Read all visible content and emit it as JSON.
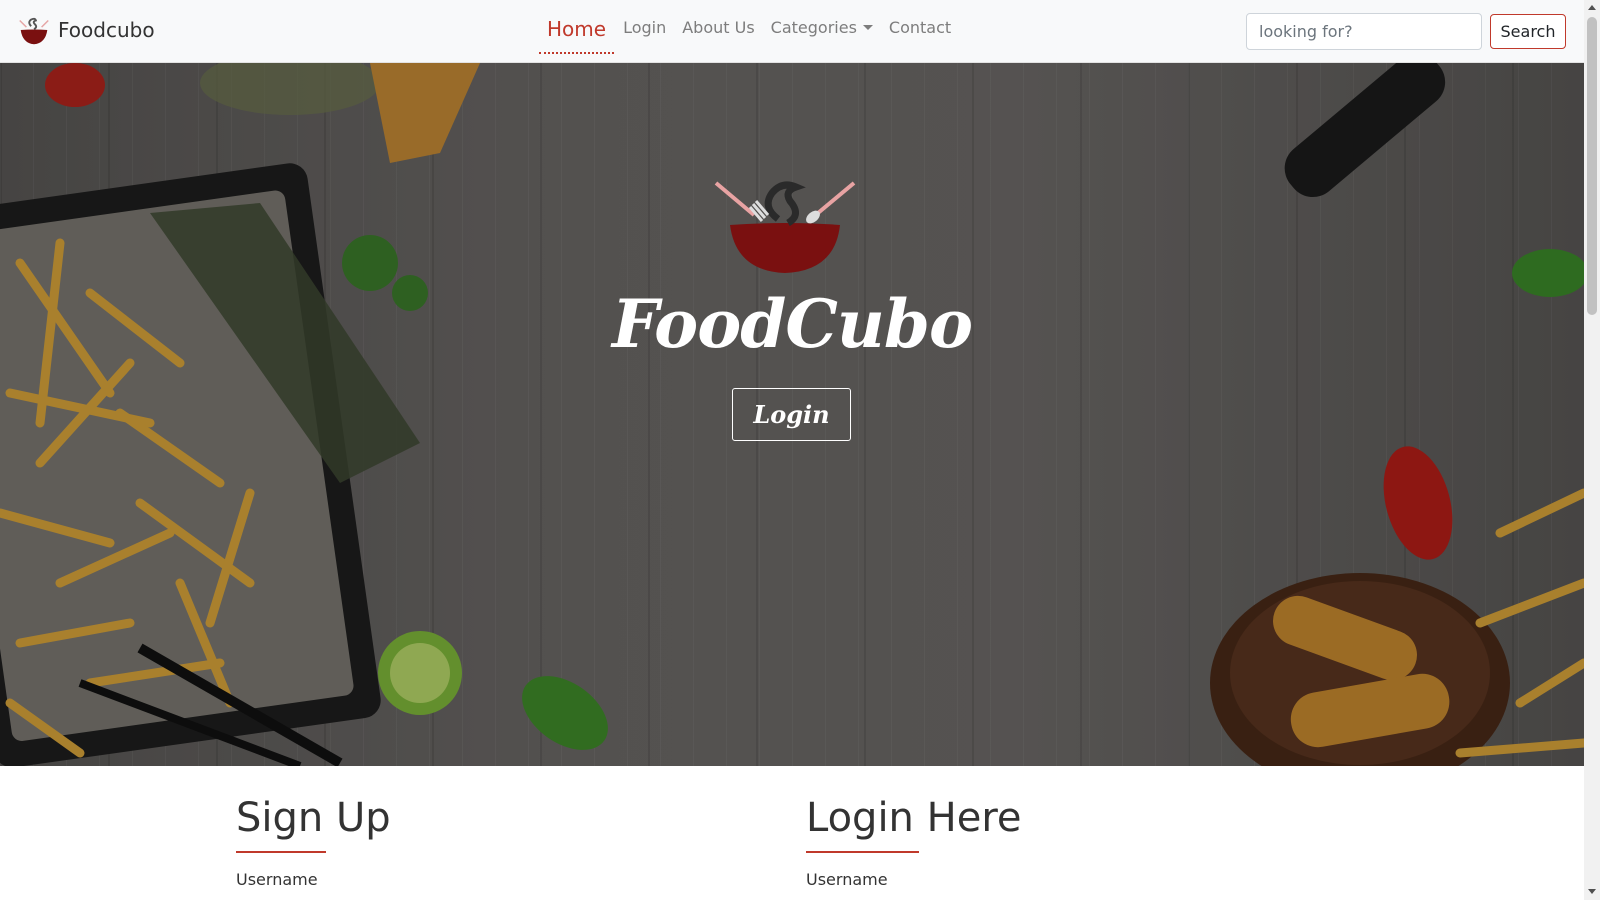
{
  "navbar": {
    "brand": "Foodcubo",
    "links": [
      {
        "label": "Home",
        "active": true
      },
      {
        "label": "Login"
      },
      {
        "label": "About Us"
      },
      {
        "label": "Categories",
        "dropdown": true
      },
      {
        "label": "Contact"
      }
    ],
    "search": {
      "placeholder": "looking for?",
      "button_label": "Search"
    }
  },
  "hero": {
    "title": "FoodCubo",
    "button_label": "Login"
  },
  "sections": {
    "signup": {
      "title": "Sign Up",
      "username_label": "Username"
    },
    "login": {
      "title": "Login Here",
      "username_label": "Username"
    }
  },
  "icons": {
    "brand": "bowl-logo-icon",
    "hero": "bowl-logo-icon",
    "dropdown": "caret-down-icon"
  },
  "colors": {
    "accent": "#c0392b",
    "bowl": "#7a1010",
    "navbar_bg": "#f8f9fa",
    "hero_overlay": "#5f5c5a"
  }
}
